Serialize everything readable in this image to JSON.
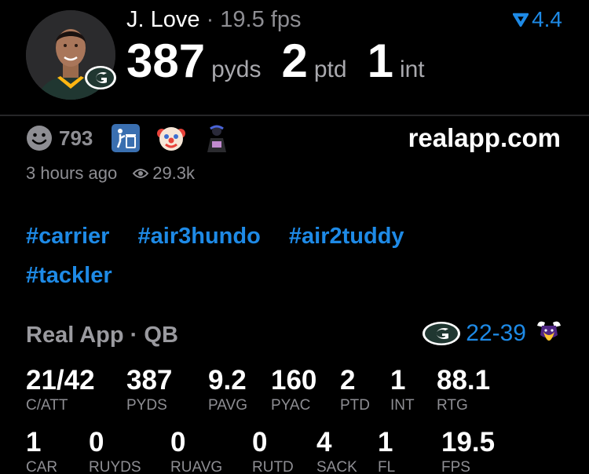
{
  "player": {
    "name": "J. Love",
    "separator": "·",
    "fps": "19.5 fps",
    "trend_value": "4.4",
    "passing_yards": "387",
    "passing_yards_unit": "pyds",
    "passing_tds": "2",
    "passing_tds_unit": "ptd",
    "interceptions": "1",
    "interceptions_unit": "int"
  },
  "social": {
    "reaction_count": "793",
    "site": "realapp.com",
    "posted": "3 hours ago",
    "views": "29.3k"
  },
  "hashtags": [
    "#carrier",
    "#air3hundo",
    "#air2tuddy",
    "#tackler"
  ],
  "game": {
    "source": "Real App · QB",
    "score": "22-39"
  },
  "stats_row1": [
    {
      "value": "21/42",
      "label": "C/ATT"
    },
    {
      "value": "387",
      "label": "PYDS"
    },
    {
      "value": "9.2",
      "label": "PAVG"
    },
    {
      "value": "160",
      "label": "PYAC"
    },
    {
      "value": "2",
      "label": "PTD"
    },
    {
      "value": "1",
      "label": "INT"
    },
    {
      "value": "88.1",
      "label": "RTG"
    }
  ],
  "stats_row2": [
    {
      "value": "1",
      "label": "CAR"
    },
    {
      "value": "0",
      "label": "RUYDS"
    },
    {
      "value": "0",
      "label": "RUAVG"
    },
    {
      "value": "0",
      "label": "RUTD"
    },
    {
      "value": "4",
      "label": "SACK"
    },
    {
      "value": "1",
      "label": "FL"
    },
    {
      "value": "19.5",
      "label": "FPS"
    }
  ],
  "colors": {
    "accent": "#1e8ae6",
    "muted": "#8e8e93",
    "background": "#000000",
    "packers_green": "#203731",
    "packers_gold": "#ffb612"
  },
  "icons": [
    "trend-arrow-icon",
    "smile-icon",
    "trash-person-icon",
    "clown-icon",
    "player-emoji-icon",
    "eye-icon",
    "packers-logo-icon",
    "vikings-logo-icon"
  ]
}
